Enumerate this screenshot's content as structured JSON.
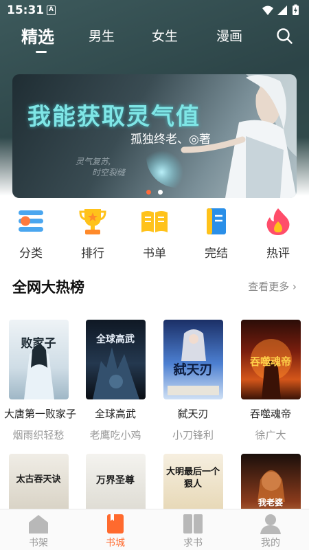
{
  "status": {
    "time": "15:31",
    "notification_letter": "A"
  },
  "nav": {
    "tabs": [
      {
        "label": "精选",
        "active": true
      },
      {
        "label": "男生",
        "active": false
      },
      {
        "label": "女生",
        "active": false
      },
      {
        "label": "漫画",
        "active": false
      }
    ],
    "search_icon": "search-icon"
  },
  "banner": {
    "title": "我能获取灵气值",
    "subtitle": "孤独终老、◎著",
    "slogan_line1": "灵气复苏,",
    "slogan_line2": "时空裂缝",
    "dots": 2,
    "active_dot": 0
  },
  "categories": [
    {
      "label": "分类",
      "icon": "category-list-icon",
      "color": "#ff7a3d"
    },
    {
      "label": "排行",
      "icon": "trophy-icon",
      "color": "#ffc21a"
    },
    {
      "label": "书单",
      "icon": "open-book-icon",
      "color": "#ffc21a"
    },
    {
      "label": "完结",
      "icon": "bookmark-book-icon",
      "color": "#2a8fe8"
    },
    {
      "label": "热评",
      "icon": "flame-icon",
      "color": "#ff4d6a"
    }
  ],
  "section": {
    "title": "全网大热榜",
    "more": "查看更多"
  },
  "books_row1": [
    {
      "title": "大唐第一败家子",
      "author": "烟雨织轻愁",
      "cover_text": "败家子"
    },
    {
      "title": "全球高武",
      "author": "老鹰吃小鸡",
      "cover_text": "全球高武"
    },
    {
      "title": "弑天刃",
      "author": "小刀锋利",
      "cover_text": "弑天刃"
    },
    {
      "title": "吞噬魂帝",
      "author": "徐广大",
      "cover_text": "吞噬魂帝"
    }
  ],
  "books_row2": [
    {
      "cover_text": "太古吞天诀"
    },
    {
      "cover_text": "万界圣尊"
    },
    {
      "cover_text": "大明最后一个狠人"
    },
    {
      "cover_text": "我老婆"
    }
  ],
  "tab_bar": [
    {
      "label": "书架",
      "icon": "bookshelf-icon",
      "active": false
    },
    {
      "label": "书城",
      "icon": "bookstore-icon",
      "active": true
    },
    {
      "label": "求书",
      "icon": "request-book-icon",
      "active": false
    },
    {
      "label": "我的",
      "icon": "profile-icon",
      "active": false
    }
  ],
  "colors": {
    "accent": "#ff6a2e",
    "header_bg": "#2c4447"
  }
}
